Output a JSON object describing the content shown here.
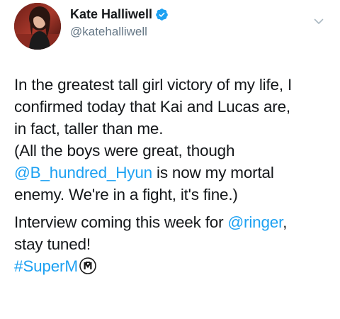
{
  "author": {
    "display_name": "Kate Halliwell",
    "handle": "@katehalliwell",
    "verified": true
  },
  "tweet": {
    "para1": {
      "line1": "In the greatest tall girl victory of my life, I",
      "line2": "confirmed today that Kai and Lucas are,",
      "line3": "in fact, taller than me.",
      "line4": "(All the boys were great, though",
      "mention_hyun": "@B_hundred_Hyun",
      "line5_rest": " is now my mortal",
      "line6": "enemy. We're in a fight, it's fine.)"
    },
    "para2": {
      "line1_pre": "Interview coming this week for ",
      "mention_ringer": "@ringer",
      "line1_post": ",",
      "line2": "stay tuned!",
      "hashtag": "#SuperM"
    }
  },
  "icons": {
    "verified": "verified-badge-icon",
    "menu": "chevron-down-icon",
    "hashflag": "superm-hashflag-icon"
  },
  "colors": {
    "link": "#1da1f2",
    "verified": "#1da1f2",
    "handle": "#657786",
    "text": "#14171a"
  }
}
